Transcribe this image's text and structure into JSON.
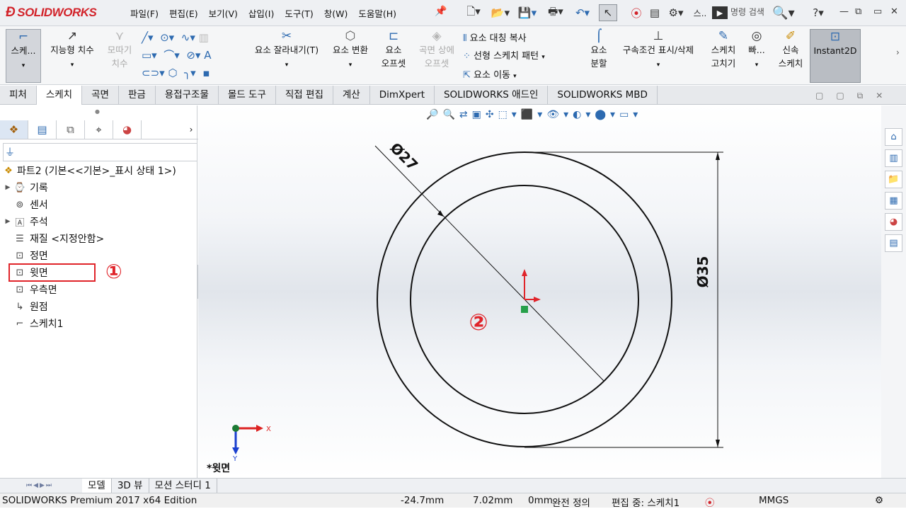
{
  "app": {
    "logo": "SOLIDWORKS"
  },
  "menu": [
    "파일(F)",
    "편집(E)",
    "보기(V)",
    "삽입(I)",
    "도구(T)",
    "창(W)",
    "도움말(H)"
  ],
  "quick": {
    "overflow": "스..",
    "command_search": "명령 검색",
    "help": "?"
  },
  "ribbon": {
    "sketch": "스케...",
    "smart_dim": "지능형 치수",
    "chamfer1": "모따기",
    "chamfer2": "치수",
    "trim": "요소 잘라내기(T)",
    "convert": "요소 변환",
    "offset1": "요소",
    "offset2": "오프셋",
    "surfoff1": "곡면 상에",
    "surfoff2": "오프셋",
    "mirror": "요소 대칭 복사",
    "pattern": "선형 스케치 패턴",
    "move": "요소 이동",
    "split1": "요소",
    "split2": "분할",
    "relations": "구속조건 표시/삭제",
    "repair1": "스케치",
    "repair2": "고치기",
    "quick": "빠...",
    "rapid1": "신속",
    "rapid2": "스케치",
    "instant2d": "Instant2D"
  },
  "tabs": [
    "피처",
    "스케치",
    "곡면",
    "판금",
    "용접구조물",
    "몰드 도구",
    "직접 편집",
    "계산",
    "DimXpert",
    "SOLIDWORKS 애드인",
    "SOLIDWORKS MBD"
  ],
  "active_tab": "스케치",
  "tree": {
    "root": "파트2  (기본<<기본>_표시 상태 1>)",
    "items": [
      "기록",
      "센서",
      "주석",
      "재질 <지정안함>",
      "정면",
      "윗면",
      "우측면",
      "원점",
      "스케치1"
    ]
  },
  "drawing": {
    "dim_small": "Ø27",
    "dim_large": "Ø35",
    "axis_x": "X",
    "axis_y": "Y",
    "view_label": "*윗면",
    "marker1": "①",
    "marker2": "②",
    "colors": {
      "highlight": "#e0242a",
      "dim": "#111111",
      "x_axis": "#d22",
      "y_axis": "#1a3fcf",
      "origin": "#27a04a"
    }
  },
  "bottom_tabs": [
    "모델",
    "3D 뷰",
    "모션 스터디 1"
  ],
  "active_bottom": "모델",
  "status": {
    "edition": "SOLIDWORKS Premium 2017 x64 Edition",
    "x": "-24.7mm",
    "y": "7.02mm",
    "z": "0mm",
    "defined": "완전 정의",
    "editing": "편집 중: 스케치1",
    "units": "MMGS"
  }
}
